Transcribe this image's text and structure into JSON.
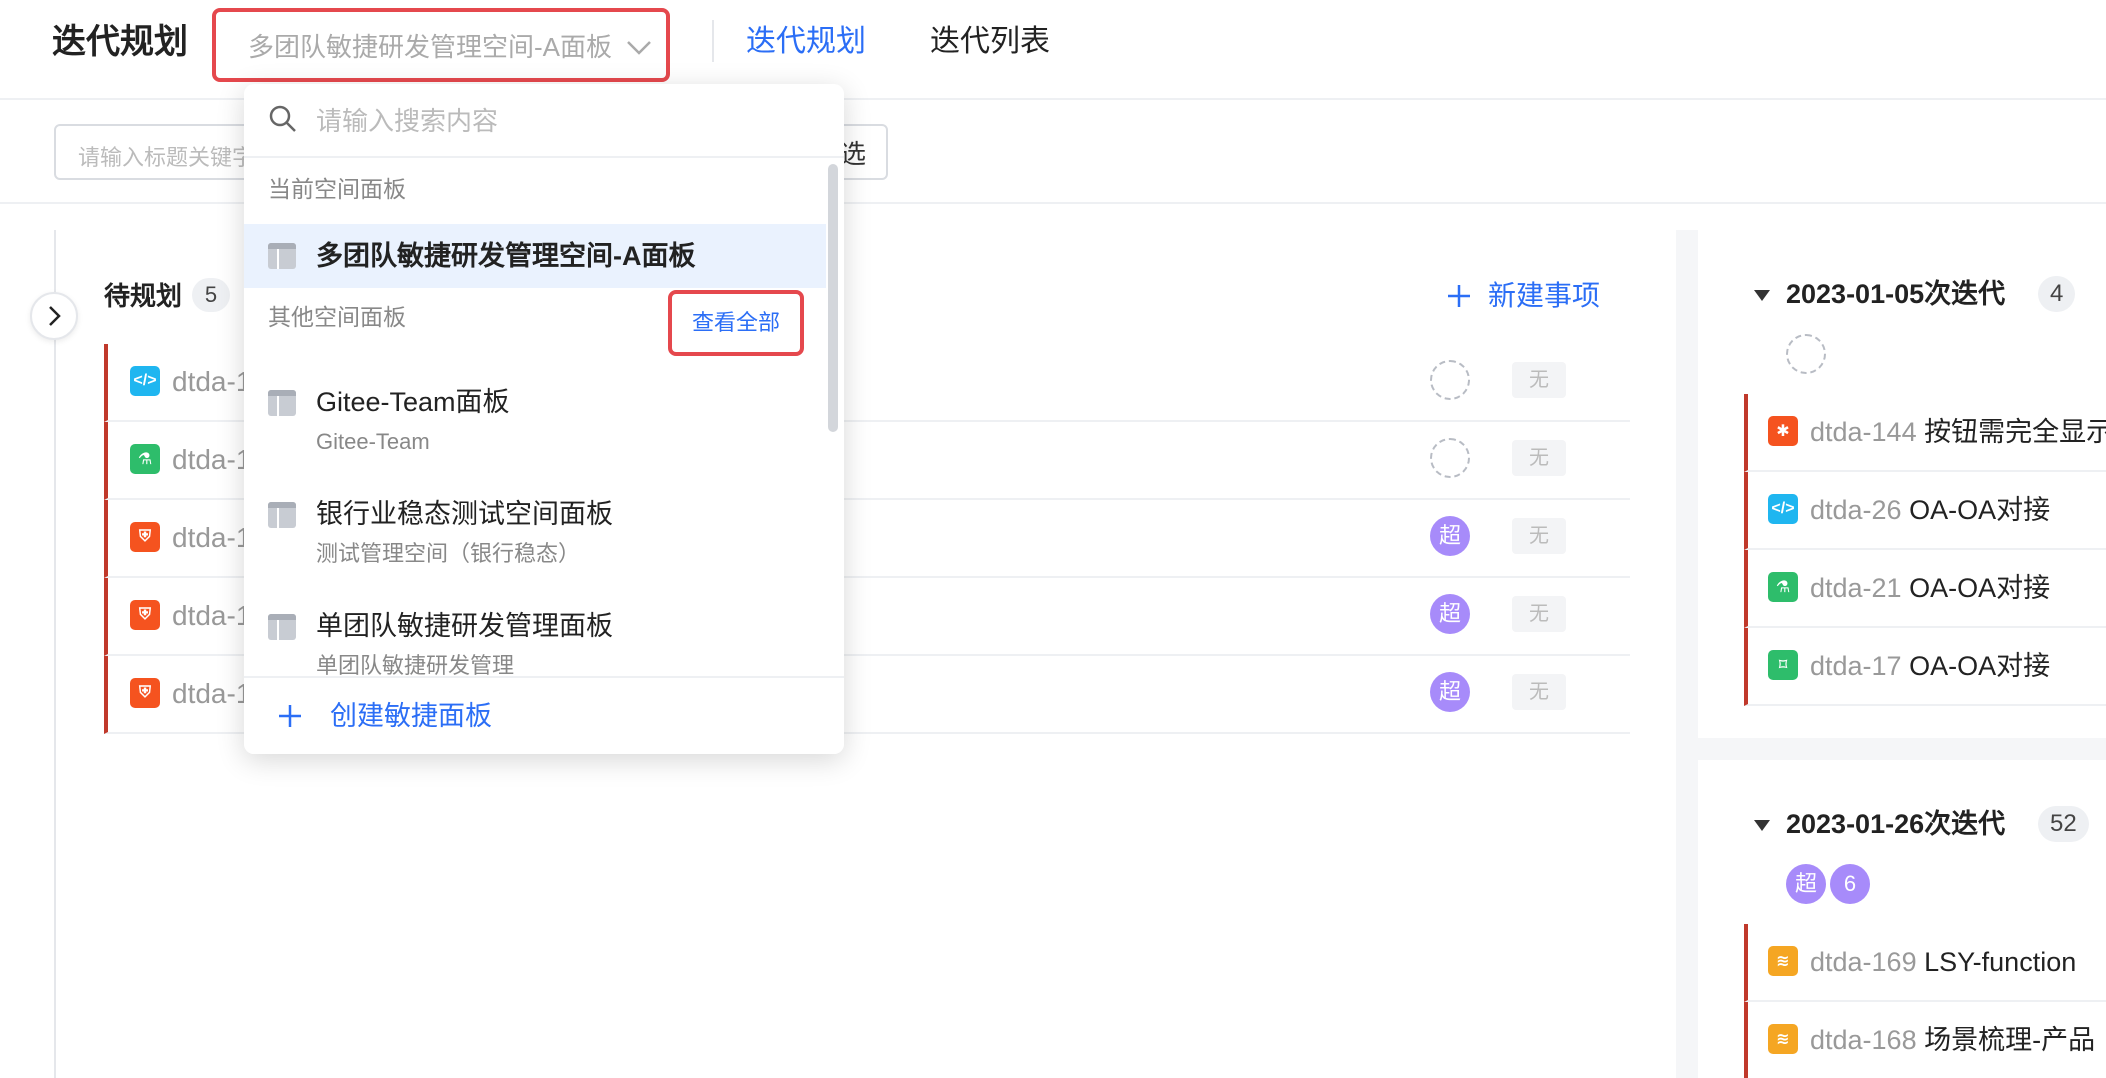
{
  "header": {
    "title": "迭代规划",
    "board_select_value": "多团队敏捷研发管理空间-A面板",
    "tabs": [
      "迭代规划",
      "迭代列表"
    ]
  },
  "filter": {
    "keyword_placeholder": "请输入标题关键字",
    "filter_button": "选"
  },
  "backlog": {
    "title": "待规划",
    "count": "5",
    "new_item_label": "新建事项",
    "rows": [
      {
        "key": "dtda-1",
        "type": "code",
        "color": "#1fb6f0",
        "assignee": "",
        "tag": "无"
      },
      {
        "key": "dtda-1",
        "type": "test",
        "color": "#2ebd6b",
        "assignee": "",
        "tag": "无"
      },
      {
        "key": "dtda-1",
        "type": "bug-shield",
        "color": "#f5531f",
        "assignee": "超",
        "tag": "无"
      },
      {
        "key": "dtda-1",
        "type": "bug-shield",
        "color": "#f5531f",
        "assignee": "超",
        "tag": "无"
      },
      {
        "key": "dtda-1",
        "type": "bug-shield",
        "color": "#f5531f",
        "assignee": "超",
        "tag": "无"
      }
    ]
  },
  "sprints": [
    {
      "name": "2023-01-05次迭代",
      "count": "4",
      "items": [
        {
          "key": "dtda-144",
          "title": "按钮需完全显示",
          "color": "#f5531f"
        },
        {
          "key": "dtda-26",
          "title": "OA-OA对接",
          "color": "#1fb6f0"
        },
        {
          "key": "dtda-21",
          "title": "OA-OA对接",
          "color": "#2ebd6b"
        },
        {
          "key": "dtda-17",
          "title": "OA-OA对接",
          "color": "#2ebd6b"
        }
      ]
    },
    {
      "name": "2023-01-26次迭代",
      "count": "52",
      "avatars": [
        "超",
        "6"
      ],
      "items": [
        {
          "key": "dtda-169",
          "title": "LSY-function",
          "color": "#f5a623"
        },
        {
          "key": "dtda-168",
          "title": "场景梳理-产品",
          "color": "#f5a623"
        }
      ]
    }
  ],
  "dropdown": {
    "search_placeholder": "请输入搜索内容",
    "current_section": "当前空间面板",
    "current_item": "多团队敏捷研发管理空间-A面板",
    "other_section": "其他空间面板",
    "view_all": "查看全部",
    "items": [
      {
        "title": "Gitee-Team面板",
        "sub": "Gitee-Team"
      },
      {
        "title": "银行业稳态测试空间面板",
        "sub": "测试管理空间（银行稳态）"
      },
      {
        "title": "单团队敏捷研发管理面板",
        "sub": "单团队敏捷研发管理"
      }
    ],
    "create_label": "创建敏捷面板"
  }
}
